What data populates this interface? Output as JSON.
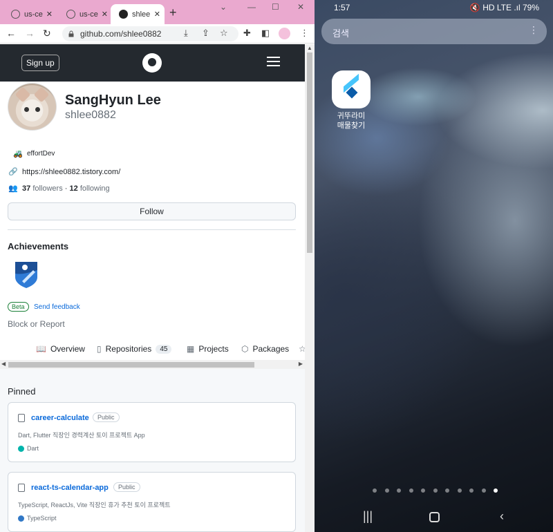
{
  "browser": {
    "tabs": [
      {
        "title": "us-ce",
        "active": false
      },
      {
        "title": "us-ce",
        "active": false
      },
      {
        "title": "shlee",
        "active": true
      }
    ],
    "new_tab_symbol": "+",
    "window_controls": [
      "⌄",
      "—",
      "☐",
      "✕"
    ],
    "url": "github.com/shlee0882"
  },
  "github": {
    "signup_label": "Sign up",
    "profile": {
      "name": "SangHyun Lee",
      "login": "shlee0882",
      "status": "effortDev",
      "website": "https://shlee0882.tistory.com/",
      "followers": "37",
      "followers_label": "followers",
      "separator": "·",
      "following": "12",
      "following_label": "following"
    },
    "follow_label": "Follow",
    "achievements_title": "Achievements",
    "beta_label": "Beta",
    "feedback_label": "Send feedback",
    "block_label": "Block or Report",
    "nav_tabs": [
      {
        "label": "Overview",
        "icon": "book-icon"
      },
      {
        "label": "Repositories",
        "icon": "repo-icon",
        "count": "45"
      },
      {
        "label": "Projects",
        "icon": "table-icon"
      },
      {
        "label": "Packages",
        "icon": "package-icon"
      }
    ],
    "pinned_title": "Pinned",
    "pinned": [
      {
        "name": "career-calculate",
        "visibility": "Public",
        "description": "Dart, Flutter 직장인 경력계산 토이 프로젝트 App",
        "language": "Dart",
        "language_color": "#00B4AB"
      },
      {
        "name": "react-ts-calendar-app",
        "visibility": "Public",
        "description": "TypeScript, ReactJs, Vite 직장인 휴가 추천 토이 프로젝트",
        "language": "TypeScript",
        "language_color": "#3178C6"
      }
    ]
  },
  "phone": {
    "time": "1:57",
    "status_icons": "🔇 HD LTE .ıl 79%",
    "search_label": "검색",
    "app_label_line1": "귀뚜라미",
    "app_label_line2": "매물찾기",
    "page_count": 11,
    "active_page": 11,
    "nav_buttons": [
      "recents",
      "home",
      "back"
    ]
  },
  "colors": {
    "tab_strip": "#eaa9cf",
    "github_header": "#24292f",
    "link": "#0969da"
  }
}
